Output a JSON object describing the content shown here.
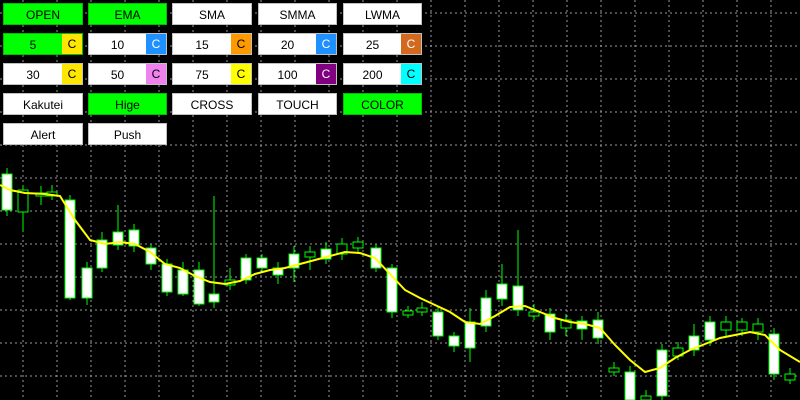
{
  "toggles_row1": [
    {
      "label": "OPEN",
      "active": true
    },
    {
      "label": "EMA",
      "active": true
    },
    {
      "label": "SMA",
      "active": false
    },
    {
      "label": "SMMA",
      "active": false
    },
    {
      "label": "LWMA",
      "active": false
    }
  ],
  "periods": [
    {
      "value": "5",
      "active": true,
      "color_label": "C",
      "color": "#ffe600",
      "text_color": "#000000"
    },
    {
      "value": "10",
      "active": false,
      "color_label": "C",
      "color": "#1e90ff",
      "text_color": "#ffffff"
    },
    {
      "value": "15",
      "active": false,
      "color_label": "C",
      "color": "#ff9900",
      "text_color": "#000000"
    },
    {
      "value": "20",
      "active": false,
      "color_label": "C",
      "color": "#1e90ff",
      "text_color": "#ffffff"
    },
    {
      "value": "25",
      "active": false,
      "color_label": "C",
      "color": "#d2691e",
      "text_color": "#ffffff"
    },
    {
      "value": "30",
      "active": false,
      "color_label": "C",
      "color": "#ffe600",
      "text_color": "#000000"
    },
    {
      "value": "50",
      "active": false,
      "color_label": "C",
      "color": "#ee82ee",
      "text_color": "#000000"
    },
    {
      "value": "75",
      "active": false,
      "color_label": "C",
      "color": "#ffff00",
      "text_color": "#000000"
    },
    {
      "value": "100",
      "active": false,
      "color_label": "C",
      "color": "#800080",
      "text_color": "#ffffff"
    },
    {
      "value": "200",
      "active": false,
      "color_label": "C",
      "color": "#00ffff",
      "text_color": "#000000"
    }
  ],
  "toggles_row4": [
    {
      "label": "Kakutei",
      "active": false
    },
    {
      "label": "Hige",
      "active": true
    },
    {
      "label": "CROSS",
      "active": false
    },
    {
      "label": "TOUCH",
      "active": false
    },
    {
      "label": "COLOR",
      "active": true
    }
  ],
  "toggles_row5": [
    {
      "label": "Alert",
      "active": false
    },
    {
      "label": "Push",
      "active": false
    }
  ],
  "colors": {
    "background": "#000000",
    "grid": "#9a9a9a",
    "bull_body": "#ffffff",
    "candle_outline": "#00ff00",
    "ma_line": "#ffff00",
    "active_button": "#00ff00"
  }
}
